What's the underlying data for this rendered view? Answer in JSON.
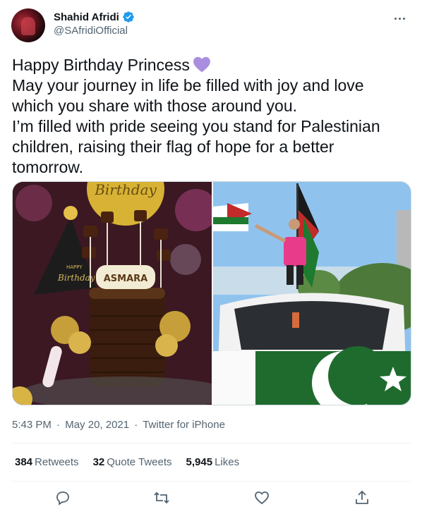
{
  "author": {
    "display_name": "Shahid Afridi",
    "handle": "@SAfridiOfficial",
    "verified": true
  },
  "tweet": {
    "lines": [
      "Happy Birthday Princess",
      "May your journey in life be filled with joy and love",
      "which you share with those around you.",
      "I’m filled with pride seeing you stand for Palestinian",
      "children, raising their flag of hope for a better",
      "tomorrow."
    ],
    "heart_emoji_color": "#a98ee0"
  },
  "media": {
    "left_image": {
      "cake_topper_text": "Birthday",
      "cake_label": "ASMARA",
      "hat_text_1": "HAPPY",
      "hat_text_2": "Birthday"
    },
    "right_image": {}
  },
  "meta": {
    "time": "5:43 PM",
    "date": "May 20, 2021",
    "source": "Twitter for iPhone"
  },
  "stats": {
    "retweets": {
      "count": "384",
      "label": "Retweets"
    },
    "quotes": {
      "count": "32",
      "label": "Quote Tweets"
    },
    "likes": {
      "count": "5,945",
      "label": "Likes"
    }
  },
  "actions": [
    "reply-icon",
    "retweet-icon",
    "like-icon",
    "share-icon"
  ],
  "colors": {
    "verified": "#1d9bf0",
    "muted": "#536471",
    "text": "#0f1419",
    "divider": "#eff3f4"
  }
}
